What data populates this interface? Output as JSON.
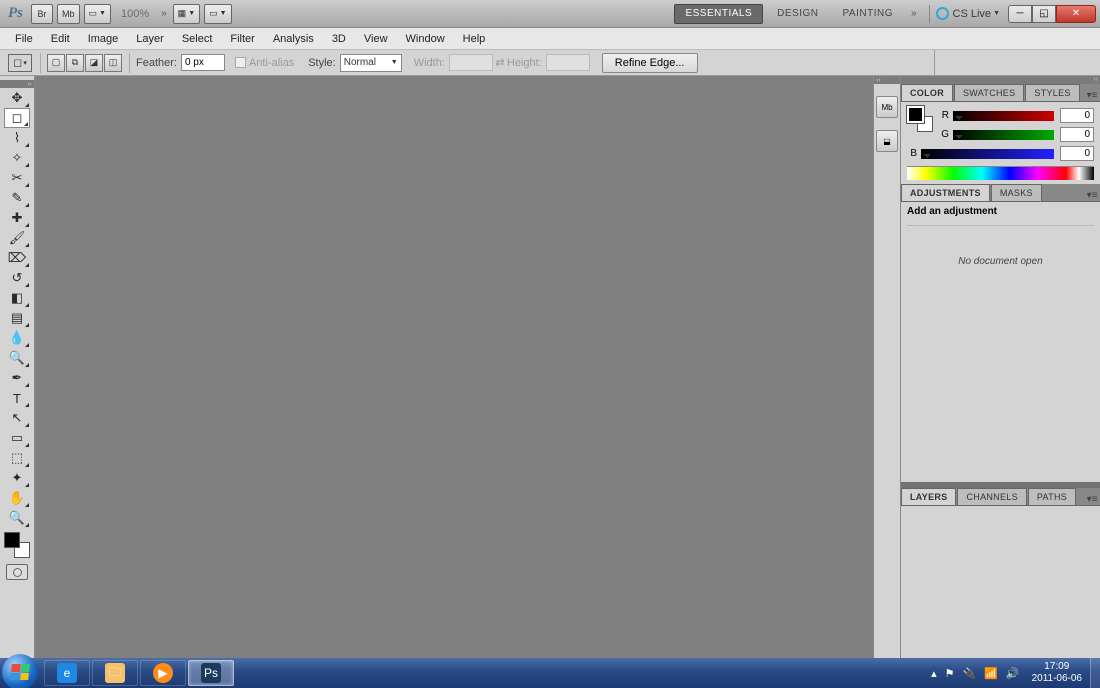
{
  "titlebar": {
    "app_abbr": "Ps",
    "br_label": "Br",
    "mb_label": "Mb",
    "zoom": "100%",
    "workspaces": [
      "ESSENTIALS",
      "DESIGN",
      "PAINTING"
    ],
    "active_ws": 0,
    "cslive": "CS Live"
  },
  "menu": [
    "File",
    "Edit",
    "Image",
    "Layer",
    "Select",
    "Filter",
    "Analysis",
    "3D",
    "View",
    "Window",
    "Help"
  ],
  "options": {
    "feather_label": "Feather:",
    "feather_value": "0 px",
    "antialias": "Anti-alias",
    "style_label": "Style:",
    "style_value": "Normal",
    "width_label": "Width:",
    "height_label": "Height:",
    "refine": "Refine Edge..."
  },
  "tools": [
    {
      "name": "move-tool",
      "glyph": "✥"
    },
    {
      "name": "marquee-tool",
      "glyph": "◻",
      "selected": true
    },
    {
      "name": "lasso-tool",
      "glyph": "⌇"
    },
    {
      "name": "wand-tool",
      "glyph": "✧"
    },
    {
      "name": "crop-tool",
      "glyph": "✂"
    },
    {
      "name": "eyedropper-tool",
      "glyph": "✎"
    },
    {
      "name": "healing-tool",
      "glyph": "✚"
    },
    {
      "name": "brush-tool",
      "glyph": "🖌"
    },
    {
      "name": "stamp-tool",
      "glyph": "⌦"
    },
    {
      "name": "history-brush-tool",
      "glyph": "↺"
    },
    {
      "name": "eraser-tool",
      "glyph": "◧"
    },
    {
      "name": "gradient-tool",
      "glyph": "▤"
    },
    {
      "name": "blur-tool",
      "glyph": "💧"
    },
    {
      "name": "dodge-tool",
      "glyph": "🔍"
    },
    {
      "name": "pen-tool",
      "glyph": "✒"
    },
    {
      "name": "type-tool",
      "glyph": "T"
    },
    {
      "name": "path-tool",
      "glyph": "↖"
    },
    {
      "name": "shape-tool",
      "glyph": "▭"
    },
    {
      "name": "3d-tool",
      "glyph": "⬚"
    },
    {
      "name": "camera-tool",
      "glyph": "✦"
    },
    {
      "name": "hand-tool",
      "glyph": "✋"
    },
    {
      "name": "zoom-tool",
      "glyph": "🔍"
    }
  ],
  "color_panel": {
    "tabs": [
      "COLOR",
      "SWATCHES",
      "STYLES"
    ],
    "channels": [
      {
        "ch": "R",
        "val": "0"
      },
      {
        "ch": "G",
        "val": "0"
      },
      {
        "ch": "B",
        "val": "0"
      }
    ]
  },
  "adjustments_panel": {
    "tabs": [
      "ADJUSTMENTS",
      "MASKS"
    ],
    "title": "Add an adjustment",
    "empty": "No document open"
  },
  "layers_panel": {
    "tabs": [
      "LAYERS",
      "CHANNELS",
      "PATHS"
    ]
  },
  "dock_strip": [
    "Mb",
    "⬓"
  ],
  "taskbar": {
    "time": "17:09",
    "date": "2011-06-06"
  }
}
